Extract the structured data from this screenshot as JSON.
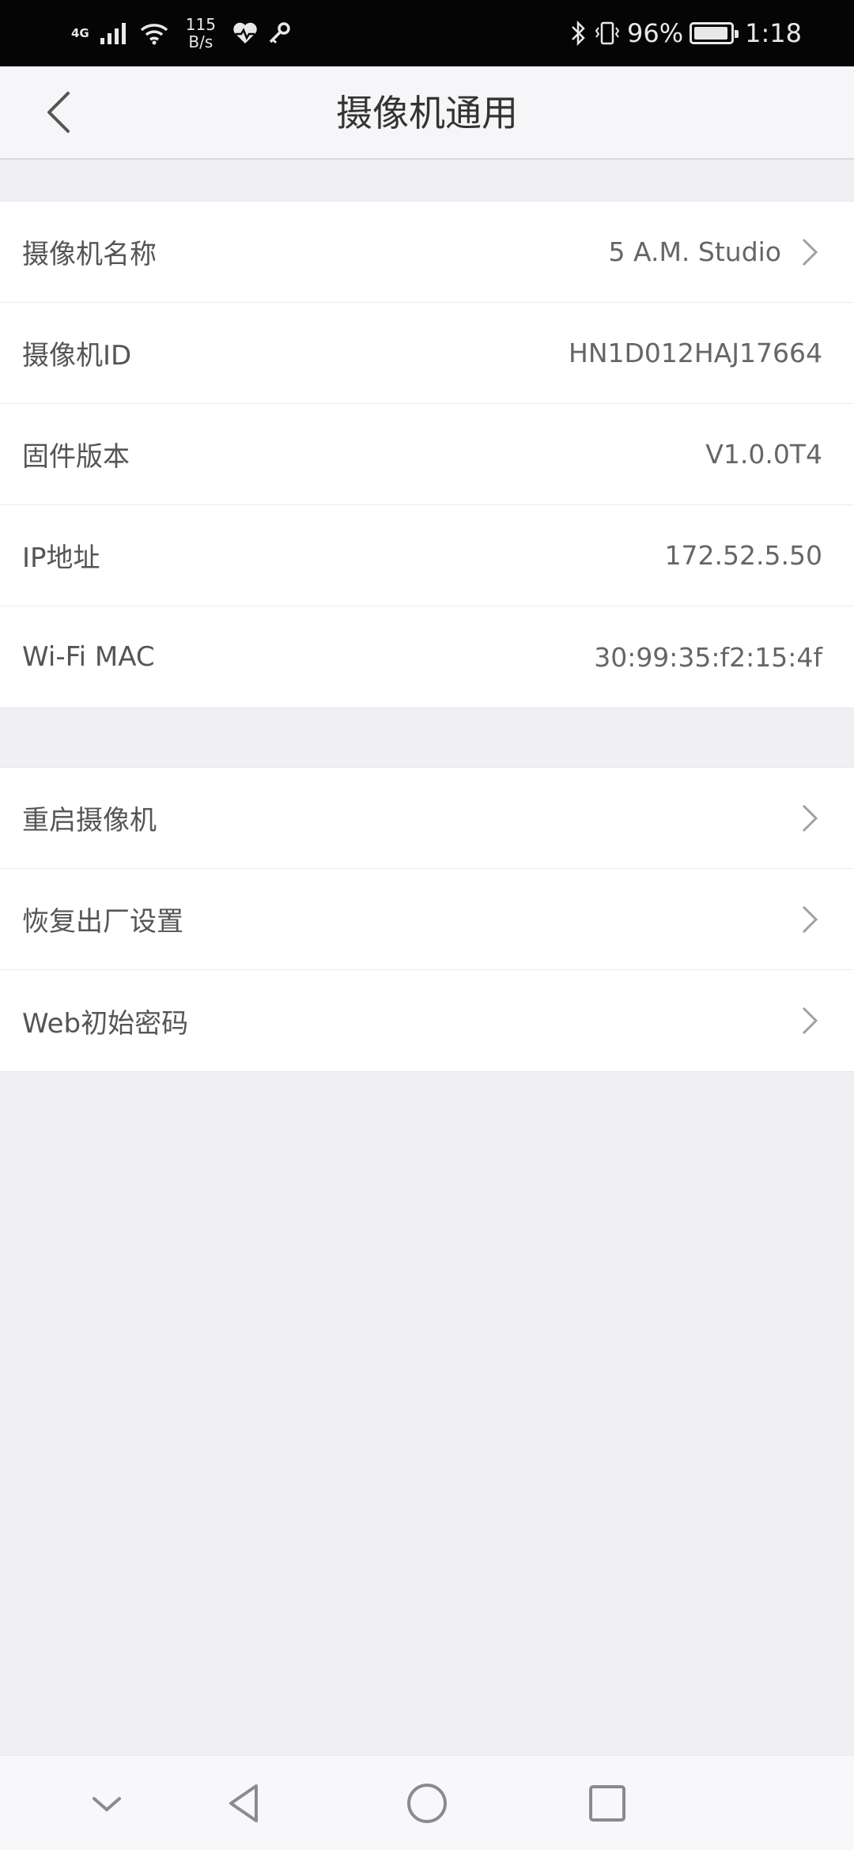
{
  "status_bar": {
    "network_type": "4G",
    "speed_value": "115",
    "speed_unit": "B/s",
    "battery_percent_text": "96%",
    "battery_level": 0.96,
    "time": "1:18"
  },
  "header": {
    "title": "摄像机通用"
  },
  "info_group": [
    {
      "label": "摄像机名称",
      "value": "5 A.M. Studio",
      "has_chevron": true
    },
    {
      "label": "摄像机ID",
      "value": "HN1D012HAJ17664",
      "has_chevron": false
    },
    {
      "label": "固件版本",
      "value": "V1.0.0T4",
      "has_chevron": false
    },
    {
      "label": "IP地址",
      "value": "172.52.5.50",
      "has_chevron": false
    },
    {
      "label": "Wi-Fi MAC",
      "value": "30:99:35:f2:15:4f",
      "has_chevron": false
    }
  ],
  "action_group": [
    {
      "label": "重启摄像机"
    },
    {
      "label": "恢复出厂设置"
    },
    {
      "label": "Web初始密码"
    }
  ],
  "nav_bar": {
    "icons": [
      "collapse-icon",
      "back-triangle-icon",
      "home-circle-icon",
      "recents-square-icon"
    ]
  },
  "colors": {
    "background": "#efeff4",
    "status_bar": "#050505",
    "text_primary": "#555555",
    "text_secondary": "#666666",
    "chevron": "#a0a0a8"
  }
}
